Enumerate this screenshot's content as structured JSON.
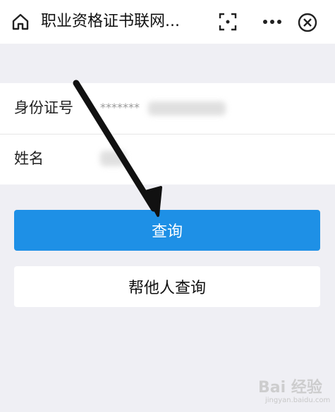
{
  "header": {
    "title": "职业资格证书联网...",
    "home_icon": "home-icon",
    "scan_icon": "scan-icon",
    "more_icon": "more-icon",
    "close_icon": "close-icon"
  },
  "form": {
    "id_label": "身份证号",
    "id_value": "*******",
    "name_label": "姓名"
  },
  "buttons": {
    "query": "查询",
    "help_query": "帮他人查询"
  },
  "annotation": {
    "arrow_icon": "arrow-annotation"
  },
  "watermark": {
    "text": "Bai 经验",
    "sub": "jingyan.baidu.com"
  },
  "colors": {
    "primary": "#1e90e6",
    "background": "#efeff4"
  }
}
